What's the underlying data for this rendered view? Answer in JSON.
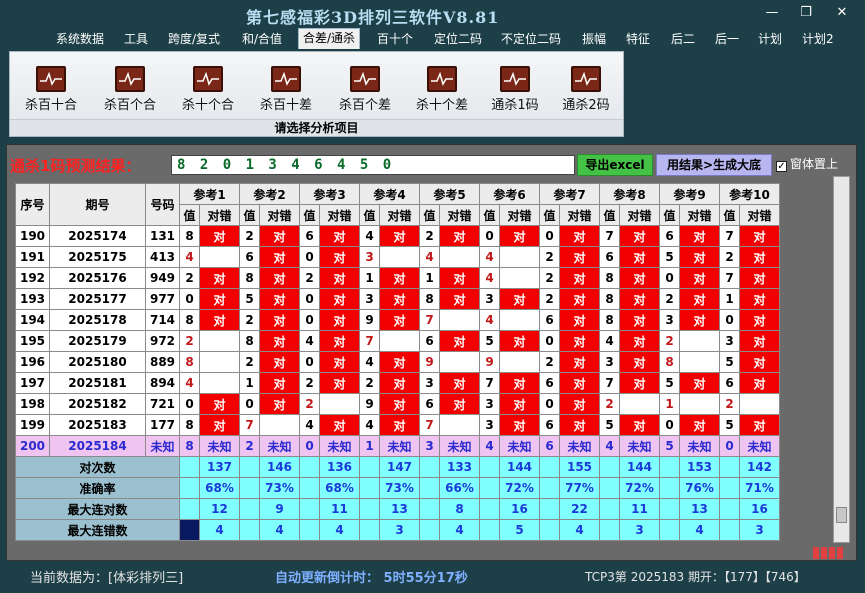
{
  "window": {
    "title": "第七感福彩3D排列三软件V8.81",
    "minimize": "—",
    "restore": "❐",
    "close": "✕"
  },
  "menu": [
    "系统数据",
    "工具",
    "跨度/复式",
    "和/合值",
    "合差/通杀",
    "百十个",
    "定位二码",
    "不定位二码",
    "振幅",
    "特征",
    "后二",
    "后一",
    "计划",
    "计划2"
  ],
  "menu_active_index": 4,
  "ribbon": {
    "buttons": [
      "杀百十合",
      "杀百个合",
      "杀十个合",
      "杀百十差",
      "杀百个差",
      "杀十个差",
      "通杀1码",
      "通杀2码"
    ],
    "caption": "请选择分析项目"
  },
  "prediction": {
    "label": "通杀1码预测结果：",
    "value": "8 2 0 1 3 4 6 4 5 0",
    "export_label": "导出excel",
    "generate_label": "用结果>生成大底",
    "ontop_label": "窗体置上",
    "ontop_checked": "✓"
  },
  "table": {
    "headers": {
      "seq": "序号",
      "period": "期号",
      "number": "号码",
      "value": "值",
      "result": "对错"
    },
    "refs": [
      "参考1",
      "参考2",
      "参考3",
      "参考4",
      "参考5",
      "参考6",
      "参考7",
      "参考8",
      "参考9",
      "参考10"
    ],
    "rows": [
      {
        "seq": "190",
        "period": "2025174",
        "num": "131",
        "c": [
          [
            "8",
            "对"
          ],
          [
            "2",
            "对"
          ],
          [
            "6",
            "对"
          ],
          [
            "4",
            "对"
          ],
          [
            "2",
            "对"
          ],
          [
            "0",
            "对"
          ],
          [
            "0",
            "对"
          ],
          [
            "7",
            "对"
          ],
          [
            "6",
            "对"
          ],
          [
            "7",
            "对"
          ]
        ]
      },
      {
        "seq": "191",
        "period": "2025175",
        "num": "413",
        "c": [
          [
            "4",
            ""
          ],
          [
            "6",
            "对"
          ],
          [
            "0",
            "对"
          ],
          [
            "3",
            ""
          ],
          [
            "4",
            ""
          ],
          [
            "4",
            ""
          ],
          [
            "2",
            "对"
          ],
          [
            "6",
            "对"
          ],
          [
            "5",
            "对"
          ],
          [
            "2",
            "对"
          ]
        ]
      },
      {
        "seq": "192",
        "period": "2025176",
        "num": "949",
        "c": [
          [
            "2",
            "对"
          ],
          [
            "8",
            "对"
          ],
          [
            "2",
            "对"
          ],
          [
            "1",
            "对"
          ],
          [
            "1",
            "对"
          ],
          [
            "4",
            ""
          ],
          [
            "2",
            "对"
          ],
          [
            "8",
            "对"
          ],
          [
            "0",
            "对"
          ],
          [
            "7",
            "对"
          ]
        ]
      },
      {
        "seq": "193",
        "period": "2025177",
        "num": "977",
        "c": [
          [
            "0",
            "对"
          ],
          [
            "5",
            "对"
          ],
          [
            "0",
            "对"
          ],
          [
            "3",
            "对"
          ],
          [
            "8",
            "对"
          ],
          [
            "3",
            "对"
          ],
          [
            "2",
            "对"
          ],
          [
            "8",
            "对"
          ],
          [
            "2",
            "对"
          ],
          [
            "1",
            "对"
          ]
        ]
      },
      {
        "seq": "194",
        "period": "2025178",
        "num": "714",
        "c": [
          [
            "8",
            "对"
          ],
          [
            "2",
            "对"
          ],
          [
            "0",
            "对"
          ],
          [
            "9",
            "对"
          ],
          [
            "7",
            ""
          ],
          [
            "4",
            ""
          ],
          [
            "6",
            "对"
          ],
          [
            "8",
            "对"
          ],
          [
            "3",
            "对"
          ],
          [
            "0",
            "对"
          ]
        ]
      },
      {
        "seq": "195",
        "period": "2025179",
        "num": "972",
        "c": [
          [
            "2",
            ""
          ],
          [
            "8",
            "对"
          ],
          [
            "4",
            "对"
          ],
          [
            "7",
            ""
          ],
          [
            "6",
            "对"
          ],
          [
            "5",
            "对"
          ],
          [
            "0",
            "对"
          ],
          [
            "4",
            "对"
          ],
          [
            "2",
            ""
          ],
          [
            "3",
            "对"
          ]
        ]
      },
      {
        "seq": "196",
        "period": "2025180",
        "num": "889",
        "c": [
          [
            "8",
            ""
          ],
          [
            "2",
            "对"
          ],
          [
            "0",
            "对"
          ],
          [
            "4",
            "对"
          ],
          [
            "9",
            ""
          ],
          [
            "9",
            ""
          ],
          [
            "2",
            "对"
          ],
          [
            "3",
            "对"
          ],
          [
            "8",
            ""
          ],
          [
            "5",
            "对"
          ]
        ]
      },
      {
        "seq": "197",
        "period": "2025181",
        "num": "894",
        "c": [
          [
            "4",
            ""
          ],
          [
            "1",
            "对"
          ],
          [
            "2",
            "对"
          ],
          [
            "2",
            "对"
          ],
          [
            "3",
            "对"
          ],
          [
            "7",
            "对"
          ],
          [
            "6",
            "对"
          ],
          [
            "7",
            "对"
          ],
          [
            "5",
            "对"
          ],
          [
            "6",
            "对"
          ]
        ]
      },
      {
        "seq": "198",
        "period": "2025182",
        "num": "721",
        "c": [
          [
            "0",
            "对"
          ],
          [
            "0",
            "对"
          ],
          [
            "2",
            ""
          ],
          [
            "9",
            "对"
          ],
          [
            "6",
            "对"
          ],
          [
            "3",
            "对"
          ],
          [
            "0",
            "对"
          ],
          [
            "2",
            ""
          ],
          [
            "1",
            ""
          ],
          [
            "2",
            ""
          ]
        ]
      },
      {
        "seq": "199",
        "period": "2025183",
        "num": "177",
        "c": [
          [
            "8",
            "对"
          ],
          [
            "7",
            ""
          ],
          [
            "4",
            "对"
          ],
          [
            "4",
            "对"
          ],
          [
            "7",
            ""
          ],
          [
            "3",
            "对"
          ],
          [
            "6",
            "对"
          ],
          [
            "5",
            "对"
          ],
          [
            "0",
            "对"
          ],
          [
            "5",
            "对"
          ]
        ]
      }
    ],
    "unknown_row": {
      "seq": "200",
      "period": "2025184",
      "num": "未知",
      "vals": [
        "8",
        "2",
        "0",
        "1",
        "3",
        "4",
        "6",
        "4",
        "5",
        "0"
      ],
      "mark": "未知"
    },
    "stats": [
      {
        "label": "对次数",
        "vals": [
          "137",
          "146",
          "136",
          "147",
          "133",
          "144",
          "155",
          "144",
          "153",
          "142"
        ]
      },
      {
        "label": "准确率",
        "vals": [
          "68%",
          "73%",
          "68%",
          "73%",
          "66%",
          "72%",
          "77%",
          "72%",
          "76%",
          "71%"
        ]
      },
      {
        "label": "最大连对数",
        "vals": [
          "12",
          "9",
          "11",
          "13",
          "8",
          "16",
          "22",
          "11",
          "13",
          "16"
        ]
      },
      {
        "label": "最大连错数",
        "vals": [
          "4",
          "4",
          "4",
          "3",
          "4",
          "5",
          "4",
          "3",
          "4",
          "3"
        ]
      }
    ]
  },
  "status": {
    "data_source": "当前数据为：[体彩排列三]",
    "countdown": "自动更新倒计时：  5时55分17秒",
    "issue": "TCP3第 2025183 期开：【177】【746】"
  },
  "colors": {
    "hit": "#f20000",
    "unknown_row": "#f0c4f0",
    "stats_bg": "#80ffff",
    "predict_text": "#0a6b2a"
  }
}
